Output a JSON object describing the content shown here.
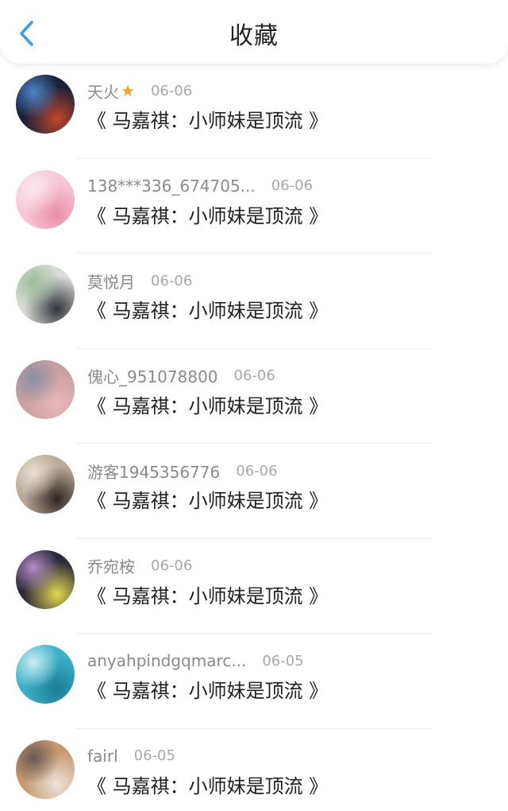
{
  "header": {
    "back_icon": "chevron-left-icon",
    "back_color": "#3a9ee8",
    "title": "收藏"
  },
  "favorites": [
    {
      "username": "天火",
      "badge": "star-icon",
      "date": "06-06",
      "title": "《 马嘉祺：小师妹是顶流 》",
      "avatar_colors": [
        "#1a2138",
        "#c2452d",
        "#4d86c9"
      ]
    },
    {
      "username": "138***336_674705...",
      "date": "06-06",
      "title": "《 马嘉祺：小师妹是顶流 》",
      "avatar_colors": [
        "#f7c9d7",
        "#eb8fa8",
        "#fbe6ee"
      ]
    },
    {
      "username": "莫悦月",
      "date": "06-06",
      "title": "《 马嘉祺：小师妹是顶流 》",
      "avatar_colors": [
        "#d8dbd6",
        "#2f333a",
        "#9dbd9a"
      ]
    },
    {
      "username": "傀心_951078800",
      "date": "06-06",
      "title": "《 马嘉祺：小师妹是顶流 》",
      "avatar_colors": [
        "#c9a09f",
        "#e8b6bd",
        "#8a8fa6"
      ]
    },
    {
      "username": "游客1945356776",
      "date": "06-06",
      "title": "《 马嘉祺：小师妹是顶流 》",
      "avatar_colors": [
        "#b9aa98",
        "#302723",
        "#e6ddd1"
      ]
    },
    {
      "username": "乔宛桉",
      "date": "06-06",
      "title": "《 马嘉祺：小师妹是顶流 》",
      "avatar_colors": [
        "#2b2a3a",
        "#e2d84f",
        "#b58ac7"
      ]
    },
    {
      "username": "anyahpindgqmarc...",
      "date": "06-05",
      "title": "《 马嘉祺：小师妹是顶流 》",
      "avatar_colors": [
        "#3db1c8",
        "#1b7d98",
        "#c8eef2"
      ]
    },
    {
      "username": "fairl",
      "date": "06-05",
      "title": "《 马嘉祺：小师妹是顶流 》",
      "avatar_colors": [
        "#c79a6e",
        "#eee4dc",
        "#6b5a54"
      ]
    }
  ]
}
